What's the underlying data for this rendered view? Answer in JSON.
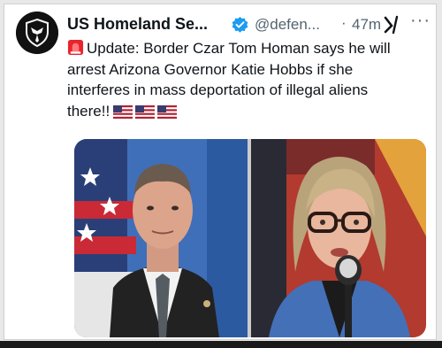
{
  "tweet": {
    "display_name": "US Homeland Se...",
    "handle": "@defen...",
    "separator": "·",
    "age": "47m",
    "more_label": "···",
    "text_lines": [
      "Update: Border Czar Tom Homan says he will",
      "arrest Arizona Governor Katie Hobbs if she",
      "interferes in mass deportation of illegal aliens",
      "there!!"
    ],
    "icons": {
      "avatar": "shield-eagle-logo",
      "verified": "verified-badge-icon",
      "grok": "grok-icon",
      "more": "more-options-icon",
      "siren": "siren-emoji-icon",
      "flags": [
        "us-flag-icon",
        "us-flag-icon",
        "us-flag-icon"
      ]
    },
    "media": {
      "images": [
        {
          "subject": "man in suit and tie in front of US flag"
        },
        {
          "subject": "woman with glasses speaking at microphone"
        }
      ]
    }
  },
  "colors": {
    "verified_blue": "#1d9bf0",
    "text_primary": "#0f1419",
    "text_secondary": "#536471"
  }
}
